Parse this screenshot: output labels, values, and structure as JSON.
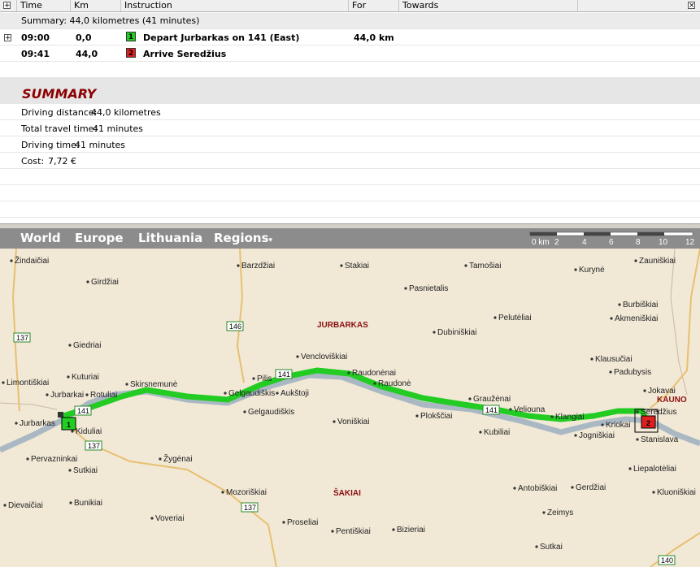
{
  "columns": [
    "Time",
    "Km",
    "Instruction",
    "For",
    "Towards"
  ],
  "summary_line": "Summary: 44,0 kilometres (41 minutes)",
  "steps": [
    {
      "time": "09:00",
      "km": "0,0",
      "num": "1",
      "instruction": "Depart Jurbarkas on 141 (East)",
      "for": "44,0 km"
    },
    {
      "time": "09:41",
      "km": "44,0",
      "num": "2",
      "instruction": "Arrive Seredžius",
      "for": ""
    }
  ],
  "summary": {
    "title": "SUMMARY",
    "rows": [
      {
        "label": "Driving distance:",
        "value": "44,0 kilometres"
      },
      {
        "label": "Total travel time:",
        "value": "41 minutes"
      },
      {
        "label": "Driving time:",
        "value": "41 minutes"
      },
      {
        "label": "Cost:",
        "value": "7,72 €"
      }
    ]
  },
  "nav": {
    "world": "World",
    "europe": "Europe",
    "lithuania": "Lithuania",
    "regions": "Regions"
  },
  "scale": {
    "labels": [
      "0 km",
      "2",
      "4",
      "6",
      "8",
      "10",
      "12"
    ]
  },
  "map": {
    "places": [
      "Žindaičiai",
      "Girdžiai",
      "Barzdžiai",
      "Stakiai",
      "Tamošiai",
      "Kurynė",
      "Zauniškiai",
      "Pasnietalis",
      "Burbiškiai",
      "Akmeniškiai",
      "Pelutėliai",
      "Dubiniškiai",
      "Giedriai",
      "Vencloviškiai",
      "Klausučiai",
      "Padubysis",
      "Limontiškiai",
      "Kuturiai",
      "Skirsnemunė",
      "Pilis",
      "Raudonėnai",
      "Raudonė",
      "Jokavai",
      "Jurbarkai",
      "Rotuliai",
      "Gelgaudiškis",
      "Aukštoji",
      "Graužėnai",
      "Seredžius",
      "Veliouna",
      "Klangiai",
      "Jurbarkas",
      "Kiduliai",
      "Gelgaudiškis",
      "Voniškiai",
      "Plokščiai",
      "Kubiliai",
      "Jogniškiai",
      "Kriokai",
      "Stanislava",
      "Pervazninkai",
      "Žygėnai",
      "Sutkiai",
      "Liepalotėliai",
      "Dievaičiai",
      "Bunikiai",
      "Mozoriškiai",
      "Antobiškiai",
      "Gerdžiai",
      "Kluoniškiai",
      "Voveriai",
      "Proseliai",
      "Zeimys",
      "Pentiškiai",
      "Bizieriai",
      "Sutkai"
    ],
    "regions": [
      "JURBARKAS",
      "ŠAKIAI",
      "KAUNO"
    ],
    "roads": [
      "137",
      "146",
      "141",
      "141",
      "137",
      "141",
      "137",
      "140"
    ],
    "markers": [
      "1",
      "2"
    ]
  },
  "colors": {
    "route": "#22cc22",
    "river": "#aab8c4",
    "road": "#e8c070",
    "region": "#8b1010"
  }
}
